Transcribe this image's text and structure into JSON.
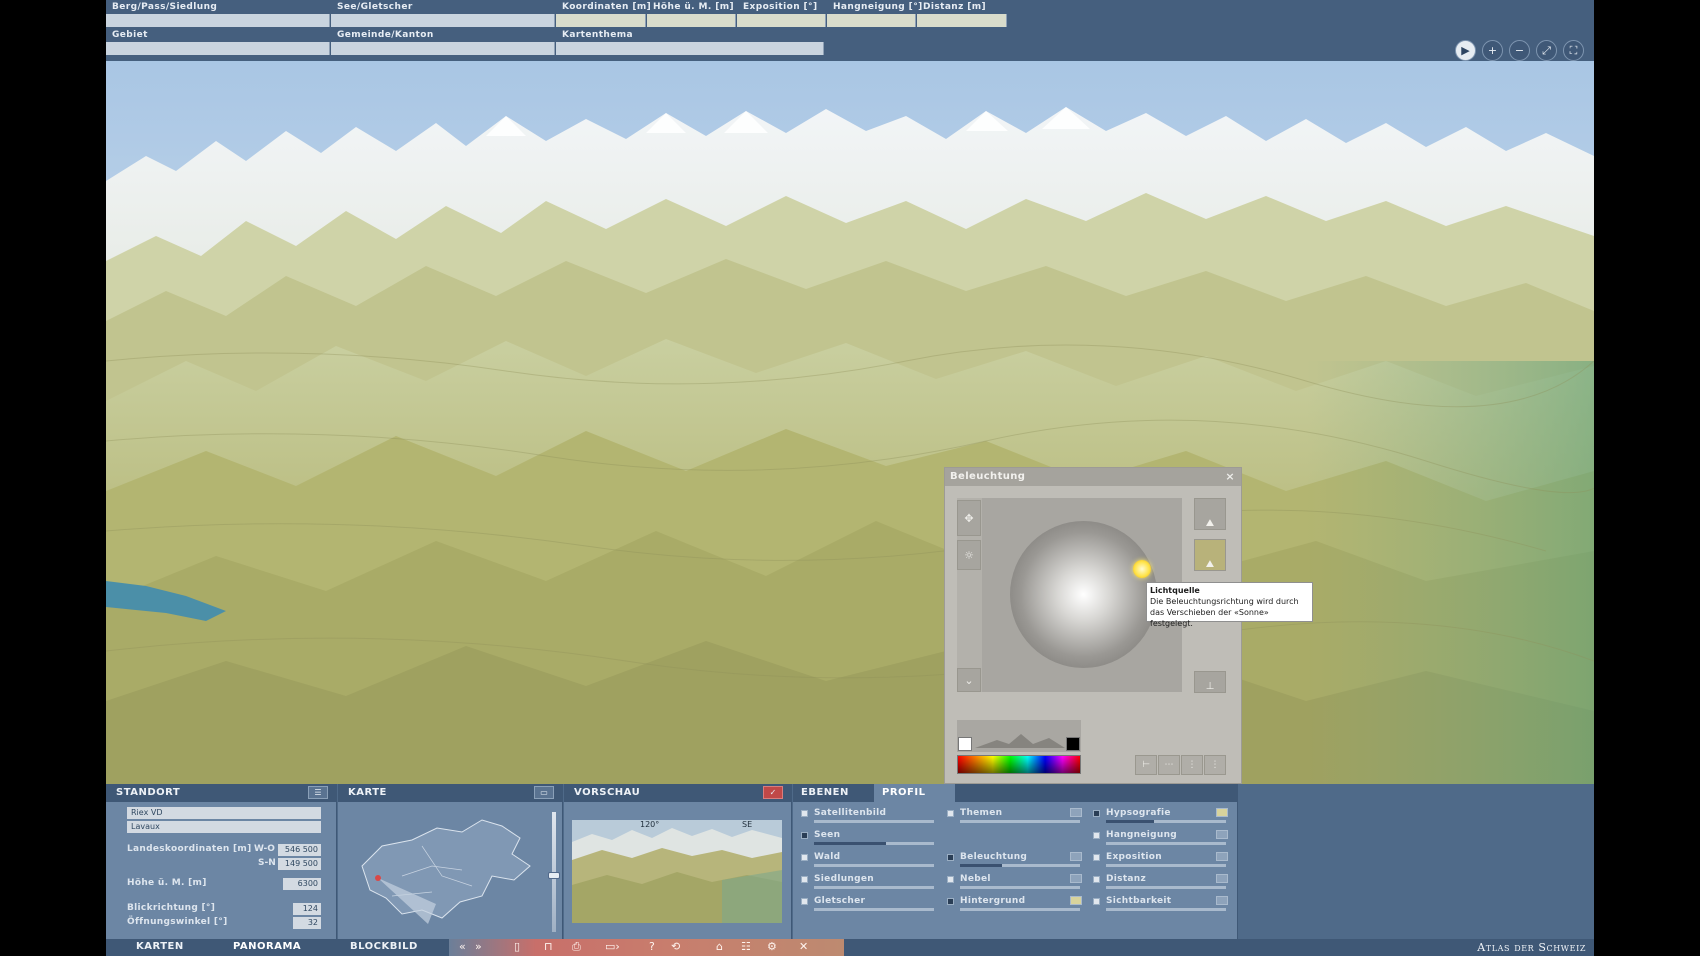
{
  "topbar": {
    "fields": [
      {
        "label": "Berg/Pass/Siedlung",
        "value": ""
      },
      {
        "label": "See/Gletscher",
        "value": ""
      },
      {
        "label": "Koordinaten [m]",
        "value": ""
      },
      {
        "label": "Höhe ü. M. [m]",
        "value": ""
      },
      {
        "label": "Exposition [°]",
        "value": ""
      },
      {
        "label": "Hangneigung [°]",
        "value": ""
      },
      {
        "label": "Distanz [m]",
        "value": ""
      },
      {
        "label": "Gebiet",
        "value": ""
      },
      {
        "label": "Gemeinde/Kanton",
        "value": ""
      },
      {
        "label": "Kartenthema",
        "value": ""
      }
    ],
    "tools": [
      {
        "icon": "play-icon",
        "glyph": "▶"
      },
      {
        "icon": "zoom-in-icon",
        "glyph": "+"
      },
      {
        "icon": "zoom-out-icon",
        "glyph": "−"
      },
      {
        "icon": "fit-view-icon",
        "glyph": "⤢"
      },
      {
        "icon": "fullscreen-icon",
        "glyph": "⛶"
      }
    ]
  },
  "dialog": {
    "title": "Beleuchtung",
    "close_glyph": "×",
    "tooltip_title": "Lichtquelle",
    "tooltip_text": "Die Beleuchtungsrichtung wird durch das Verschieben der «Sonne» festgelegt."
  },
  "standort": {
    "title": "STANDORT",
    "place": "Riex  VD",
    "region": "Lavaux",
    "coords_label": "Landeskoordinaten [m]",
    "wo_label": "W-O",
    "wo_value": "546 500",
    "sn_label": "S-N",
    "sn_value": "149 500",
    "height_label": "Höhe ü. M. [m]",
    "height_value": "6300",
    "direction_label": "Blickrichtung [°]",
    "direction_value": "124",
    "aperture_label": "Öffnungswinkel [°]",
    "aperture_value": "32"
  },
  "karte": {
    "title": "KARTE"
  },
  "vorschau": {
    "title": "VORSCHAU",
    "angle": "120°",
    "compass": "SE"
  },
  "ebenen": {
    "tab_ebenen": "EBENEN",
    "tab_profil": "PROFIL",
    "layers": [
      {
        "name": "Satellitenbild",
        "checked": false,
        "level": 0.0,
        "col": 0,
        "row": 0
      },
      {
        "name": "Seen",
        "checked": true,
        "level": 0.6,
        "col": 0,
        "row": 1
      },
      {
        "name": "Wald",
        "checked": false,
        "level": 0.0,
        "col": 0,
        "row": 2
      },
      {
        "name": "Siedlungen",
        "checked": false,
        "level": 0.0,
        "col": 0,
        "row": 3
      },
      {
        "name": "Gletscher",
        "checked": false,
        "level": 0.0,
        "col": 0,
        "row": 4
      },
      {
        "name": "Themen",
        "checked": false,
        "level": 0.0,
        "col": 1,
        "row": 0
      },
      {
        "name": "Beleuchtung",
        "checked": true,
        "level": 0.35,
        "col": 1,
        "row": 2
      },
      {
        "name": "Nebel",
        "checked": false,
        "level": 0.0,
        "col": 1,
        "row": 3
      },
      {
        "name": "Hintergrund",
        "checked": true,
        "level": 0.0,
        "col": 1,
        "row": 4
      },
      {
        "name": "Hypsografie",
        "checked": true,
        "level": 0.4,
        "col": 2,
        "row": 0
      },
      {
        "name": "Hangneigung",
        "checked": false,
        "level": 0.0,
        "col": 2,
        "row": 1
      },
      {
        "name": "Exposition",
        "checked": false,
        "level": 0.0,
        "col": 2,
        "row": 2
      },
      {
        "name": "Distanz",
        "checked": false,
        "level": 0.0,
        "col": 2,
        "row": 3
      },
      {
        "name": "Sichtbarkeit",
        "checked": false,
        "level": 0.0,
        "col": 2,
        "row": 4
      }
    ]
  },
  "nav": {
    "karten": "KARTEN",
    "panorama": "PANORAMA",
    "blockbild": "BLOCKBILD",
    "atlas": "Atlas der Schweiz"
  }
}
